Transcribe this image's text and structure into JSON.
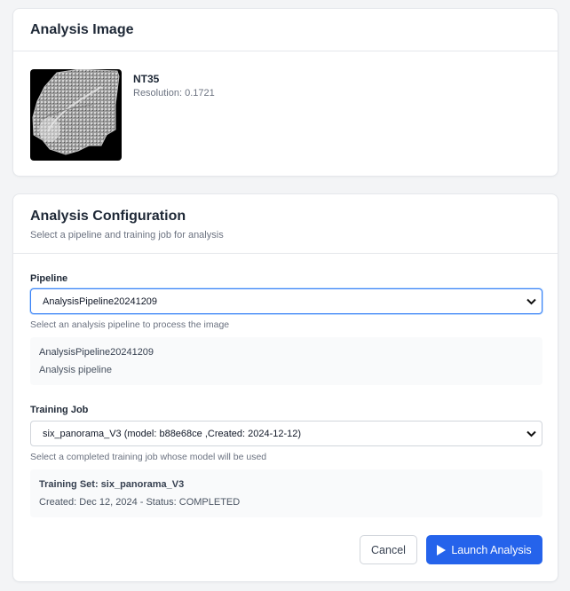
{
  "image_card": {
    "title": "Analysis Image",
    "image_name": "NT35",
    "resolution": "Resolution: 0.1721",
    "thumbnail_icon": "tissue-scan-thumbnail"
  },
  "config_card": {
    "title": "Analysis Configuration",
    "subtitle": "Select a pipeline and training job for analysis",
    "pipeline": {
      "label": "Pipeline",
      "selected": "AnalysisPipeline20241209",
      "help": "Select an analysis pipeline to process the image",
      "info_name": "AnalysisPipeline20241209",
      "info_desc": "Analysis pipeline"
    },
    "training_job": {
      "label": "Training Job",
      "selected": "six_panorama_V3 (model: b88e68ce ,Created: 2024-12-12)",
      "help": "Select a completed training job whose model will be used",
      "info_set": "Training Set: six_panorama_V3",
      "info_status": "Created: Dec 12, 2024 - Status: COMPLETED"
    },
    "buttons": {
      "cancel": "Cancel",
      "launch": "Launch Analysis"
    }
  },
  "colors": {
    "primary": "#2563eb",
    "focus_border": "#3b82f6",
    "page_bg": "#f3f4f6"
  }
}
